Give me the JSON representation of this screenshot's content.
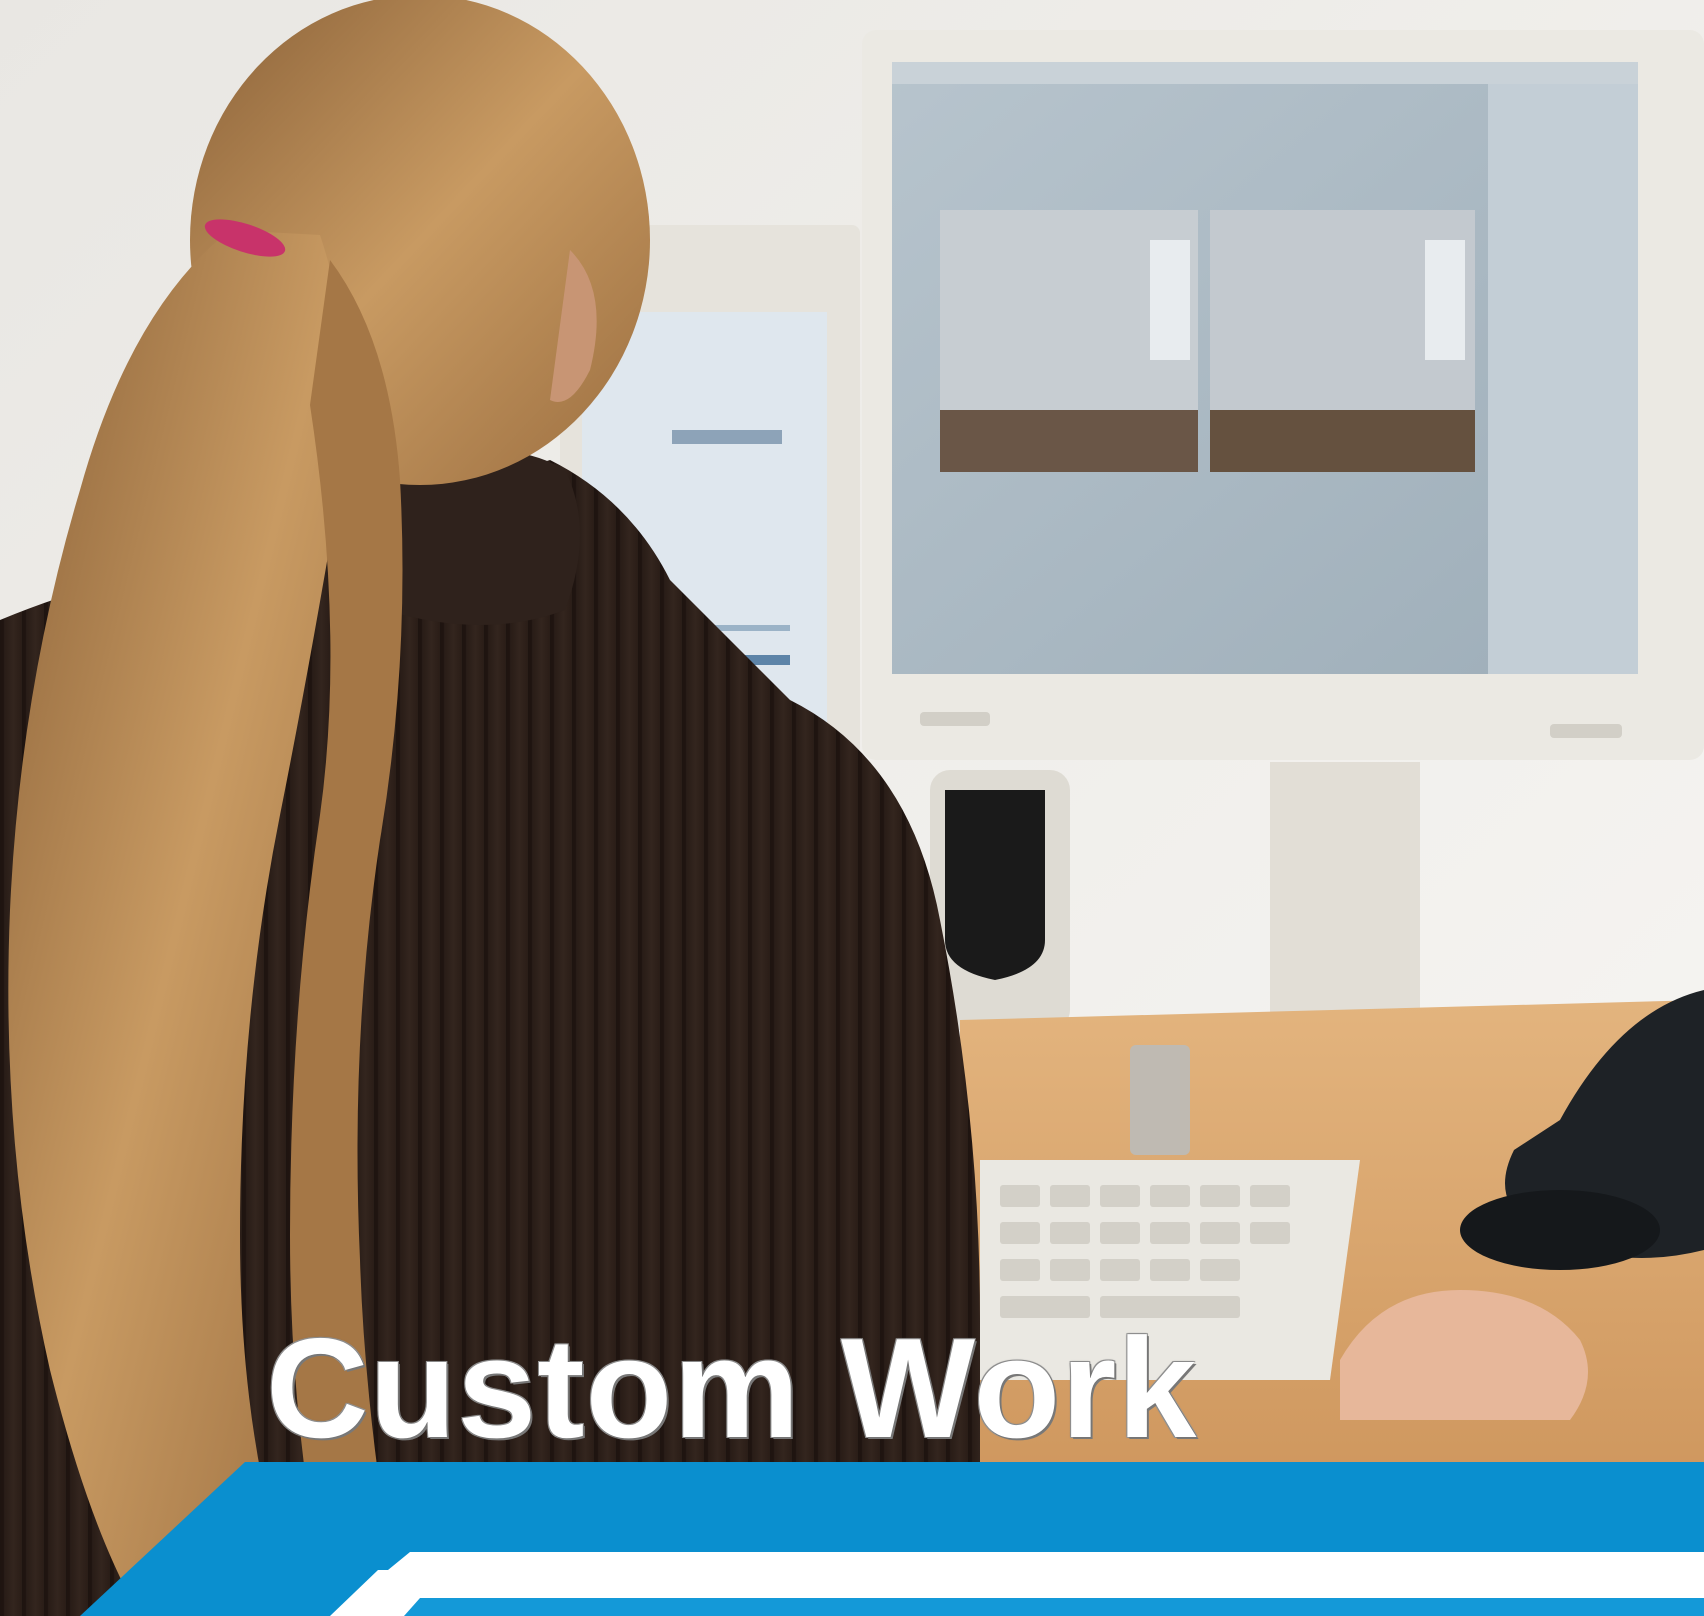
{
  "headline": "Custom Work",
  "colors": {
    "banner_blue": "#0a8fcf",
    "banner_white": "#ffffff",
    "sweater": "#2b1f1a",
    "hair": "#b88a56",
    "desk": "#d9a36a",
    "wall": "#f2f0ed",
    "monitor_frame": "#e8e6e0",
    "screen": "#a9b6c0"
  }
}
